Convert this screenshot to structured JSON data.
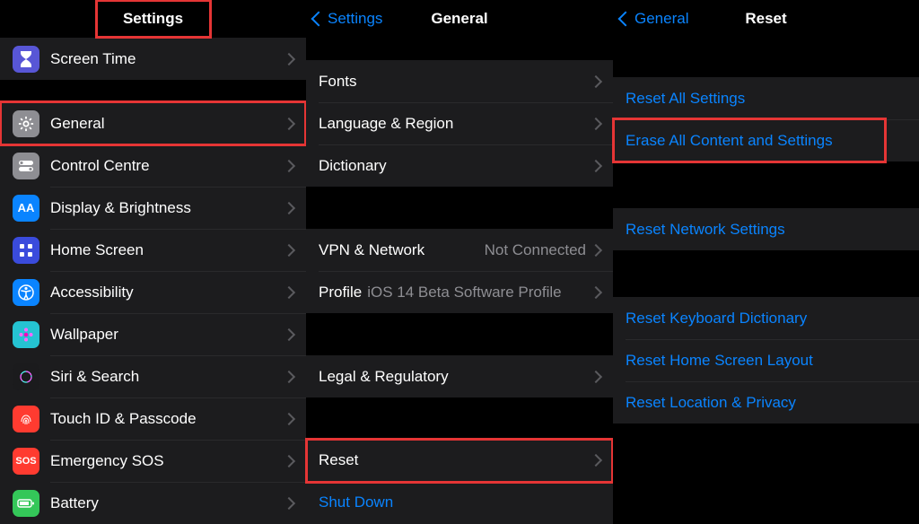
{
  "screen1": {
    "nav_title": "Settings",
    "items_top": [
      {
        "label": "Screen Time",
        "icon": "hourglass",
        "bg": "#5856d6"
      }
    ],
    "items_main": [
      {
        "label": "General",
        "icon": "gear",
        "bg": "#8e8e93"
      },
      {
        "label": "Control Centre",
        "icon": "switches",
        "bg": "#8e8e93"
      },
      {
        "label": "Display & Brightness",
        "icon": "AA",
        "bg": "#0a84ff"
      },
      {
        "label": "Home Screen",
        "icon": "grid",
        "bg": "#3a4bdc"
      },
      {
        "label": "Accessibility",
        "icon": "person",
        "bg": "#0a84ff"
      },
      {
        "label": "Wallpaper",
        "icon": "flower",
        "bg": "#25c3d2"
      },
      {
        "label": "Siri & Search",
        "icon": "siri",
        "bg": "#1b1b1d"
      },
      {
        "label": "Touch ID & Passcode",
        "icon": "fingerprint",
        "bg": "#ff3b30"
      },
      {
        "label": "Emergency SOS",
        "icon": "SOS",
        "bg": "#ff3b30"
      },
      {
        "label": "Battery",
        "icon": "battery",
        "bg": "#34c759"
      }
    ]
  },
  "screen2": {
    "back_label": "Settings",
    "nav_title": "General",
    "group1": [
      {
        "label": "Fonts"
      },
      {
        "label": "Language & Region"
      },
      {
        "label": "Dictionary"
      }
    ],
    "group2": [
      {
        "label": "VPN & Network",
        "value": "Not Connected"
      },
      {
        "label": "Profile",
        "value": "iOS 14 Beta Software Profile"
      }
    ],
    "group3": [
      {
        "label": "Legal & Regulatory"
      }
    ],
    "group4": [
      {
        "label": "Reset"
      },
      {
        "label": "Shut Down",
        "blue": true,
        "no_chevron": true
      }
    ]
  },
  "screen3": {
    "back_label": "General",
    "nav_title": "Reset",
    "group1": [
      {
        "label": "Reset All Settings"
      },
      {
        "label": "Erase All Content and Settings"
      }
    ],
    "group2": [
      {
        "label": "Reset Network Settings"
      }
    ],
    "group3": [
      {
        "label": "Reset Keyboard Dictionary"
      },
      {
        "label": "Reset Home Screen Layout"
      },
      {
        "label": "Reset Location & Privacy"
      }
    ]
  }
}
